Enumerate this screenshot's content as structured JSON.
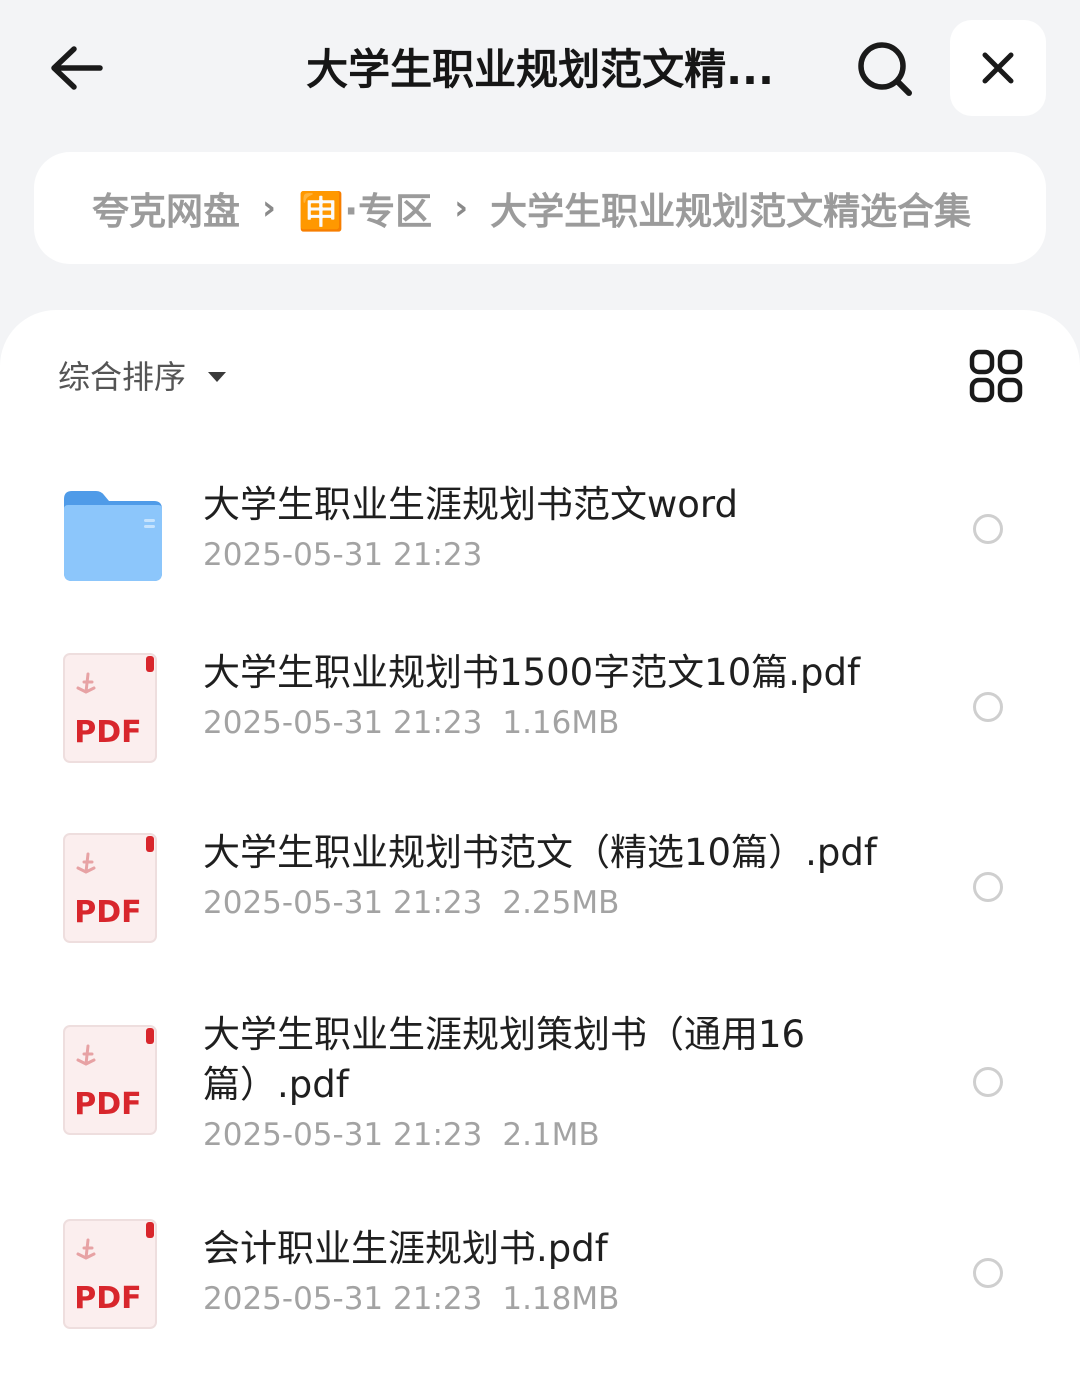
{
  "header": {
    "title": "大学生职业规划范文精..."
  },
  "breadcrumb": {
    "items": [
      "夸克网盘",
      "🈸·专区",
      "大学生职业规划范文精选合集"
    ],
    "separator": "›"
  },
  "toolbar": {
    "sort_label": "综合排序"
  },
  "files": [
    {
      "type": "folder",
      "name": "大学生职业生涯规划书范文word",
      "date": "2025-05-31 21:23",
      "size": ""
    },
    {
      "type": "pdf",
      "name": "大学生职业规划书1500字范文10篇.pdf",
      "date": "2025-05-31 21:23",
      "size": "1.16MB"
    },
    {
      "type": "pdf",
      "name": "大学生职业规划书范文（精选10篇）.pdf",
      "date": "2025-05-31 21:23",
      "size": "2.25MB"
    },
    {
      "type": "pdf",
      "name": "大学生职业生涯规划策划书（通用16篇）.pdf",
      "date": "2025-05-31 21:23",
      "size": "2.1MB"
    },
    {
      "type": "pdf",
      "name": "会计职业生涯规划书.pdf",
      "date": "2025-05-31 21:23",
      "size": "1.18MB"
    }
  ],
  "pdf_badge_text": "PDF",
  "icons": {
    "back": "arrow-left-icon",
    "search": "search-icon",
    "close": "close-icon",
    "sort": "caret-down-icon",
    "view": "grid-view-icon",
    "folder": "folder-icon",
    "pdf": "pdf-file-icon"
  },
  "colors": {
    "background": "#f3f4f6",
    "pdf_red": "#d8262c",
    "folder_blue": "#6fb3f5",
    "meta_gray": "#a3a3a3"
  }
}
